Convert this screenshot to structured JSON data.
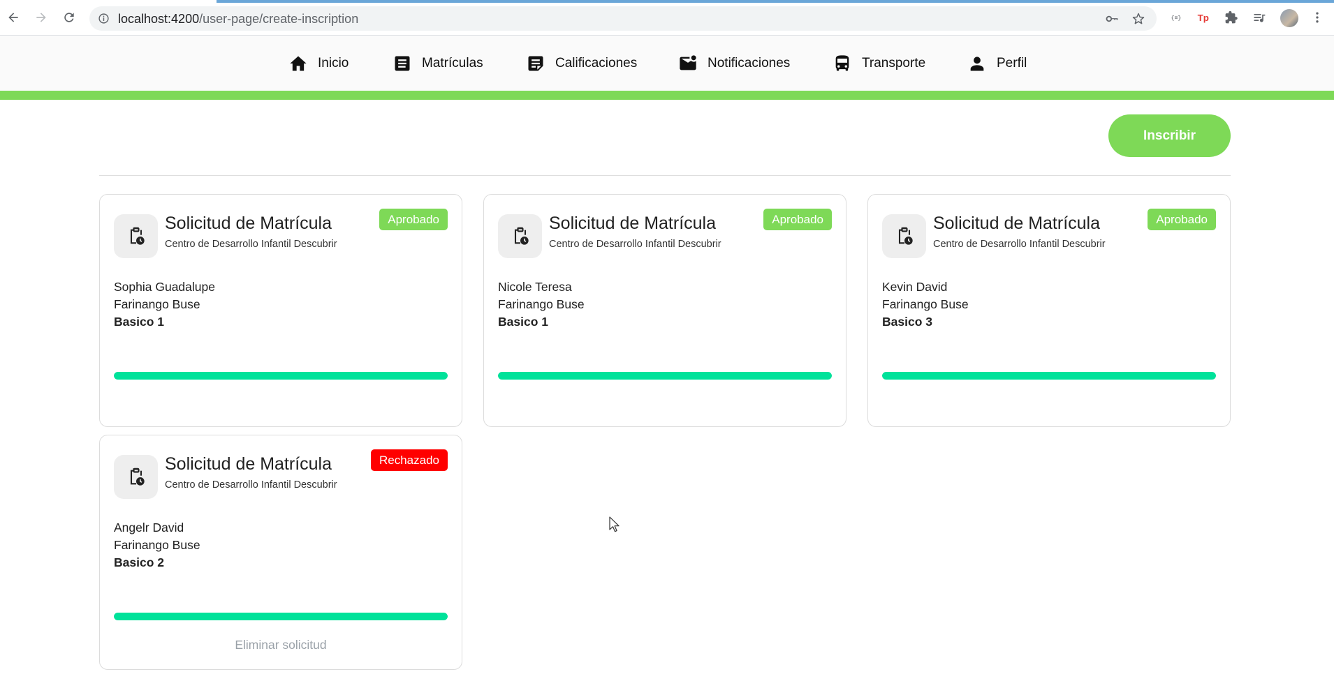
{
  "browser": {
    "url_host": "localhost:4200",
    "url_path": "/user-page/create-inscription"
  },
  "nav": {
    "items": [
      {
        "label": "Inicio",
        "icon": "home-icon"
      },
      {
        "label": "Matrículas",
        "icon": "document-icon"
      },
      {
        "label": "Calificaciones",
        "icon": "note-icon"
      },
      {
        "label": "Notificaciones",
        "icon": "mail-icon"
      },
      {
        "label": "Transporte",
        "icon": "bus-icon"
      },
      {
        "label": "Perfil",
        "icon": "person-icon"
      }
    ]
  },
  "actions": {
    "inscribir_label": "Inscribir"
  },
  "colors": {
    "accent": "#7ed957",
    "progress": "#00e29a",
    "rejected": "#ff0000"
  },
  "cards": [
    {
      "title": "Solicitud de Matrícula",
      "subtitle": "Centro de Desarrollo Infantil Descubrir",
      "status": "Aprobado",
      "first_names": "Sophia Guadalupe",
      "last_names": "Farinango Buse",
      "level": "Basico 1",
      "progress": 1.0
    },
    {
      "title": "Solicitud de Matrícula",
      "subtitle": "Centro de Desarrollo Infantil Descubrir",
      "status": "Aprobado",
      "first_names": "Nicole Teresa",
      "last_names": "Farinango Buse",
      "level": "Basico 1",
      "progress": 1.0
    },
    {
      "title": "Solicitud de Matrícula",
      "subtitle": "Centro de Desarrollo Infantil Descubrir",
      "status": "Aprobado",
      "first_names": "Kevin David",
      "last_names": "Farinango Buse",
      "level": "Basico 3",
      "progress": 1.0
    },
    {
      "title": "Solicitud de Matrícula",
      "subtitle": "Centro de Desarrollo Infantil Descubrir",
      "status": "Rechazado",
      "first_names": "Angelr David",
      "last_names": "Farinango Buse",
      "level": "Basico 2",
      "progress": 1.0,
      "delete_label": "Eliminar solicitud"
    }
  ]
}
